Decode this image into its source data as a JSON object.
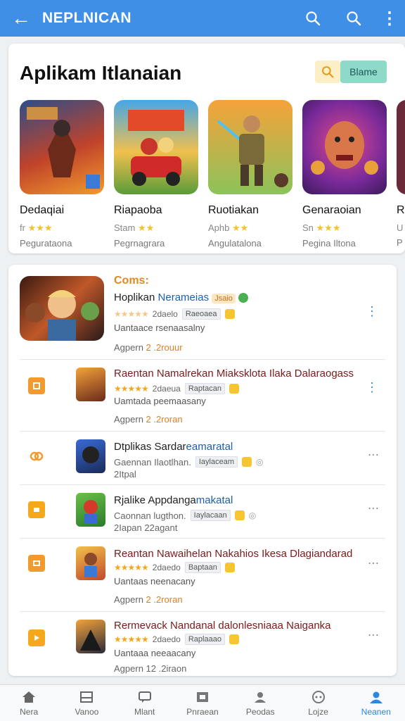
{
  "appbar": {
    "title": "NEPLNICAN",
    "back_icon": "arrow-left-icon",
    "bg": "#3f8fe6"
  },
  "featured": {
    "title": "Aplikam Itlanaian",
    "right_button": "Blame",
    "items": [
      {
        "name": "Dedaqiai",
        "rating": "fr",
        "category": "Pegurataona"
      },
      {
        "name": "Riapaoba",
        "rating": "Stam",
        "category": "Pegrnagrara"
      },
      {
        "name": "Ruotiakan",
        "rating": "Aphb",
        "category": "Angulatalona"
      },
      {
        "name": "Genaraoian",
        "rating": "Sn",
        "category": "Pegina Iltona"
      },
      {
        "name": "R",
        "rating": "U",
        "category": "P"
      }
    ]
  },
  "list": {
    "section_label": "Coms:",
    "rows": [
      {
        "title_a": "Hoplikan",
        "title_b": "Nerameias",
        "badge": "Jsaio",
        "rating": "2daelo",
        "tag": "Raeoaea",
        "desc": "Uantaace rsenaasalny",
        "sub_a": "Agpern",
        "sub_b": "2 .2rouur"
      },
      {
        "title": "Raentan Namalrekan Miaksklota Ilaka Dalaraogass",
        "rating": "2daeua",
        "tag": "Raptacan",
        "desc": "Uamtada peemaasany",
        "sub_a": "Agpern",
        "sub_b": "2 .2roran"
      },
      {
        "title_a": "Dtplikas Sardar",
        "title_b": "eamaratal",
        "desc": "Gaennan Ilaotlhan.",
        "tag": "Iaylaceam",
        "sub": "2Itpal"
      },
      {
        "title_a": "Rjalike Appdanga",
        "title_b": "makatal",
        "desc": "Caonnan lugthon.",
        "tag": "Iaylacaan",
        "sub": "2Iapan 22agant"
      },
      {
        "title": "Reantan Nawaihelan Nakahios Ikesa Dlagiandarad",
        "rating": "2daedo",
        "tag": "Baptaan",
        "desc": "Uantaas neenacany",
        "sub_a": "Agpern",
        "sub_b": "2 .2roran"
      },
      {
        "title": "Rermevack Nandanal dalonlesniaaa Naiganka",
        "rating": "2daedo",
        "tag": "Raplaaao",
        "desc": "Uantaaa neeaacany",
        "sub": "Agpern 12 .2iraon"
      }
    ]
  },
  "nav": {
    "items": [
      {
        "label": "Nera",
        "icon": "home-icon"
      },
      {
        "label": "Vanoo",
        "icon": "inbox-icon"
      },
      {
        "label": "Mlant",
        "icon": "chat-icon"
      },
      {
        "label": "Pnraean",
        "icon": "image-icon"
      },
      {
        "label": "Peodas",
        "icon": "person-icon"
      },
      {
        "label": "Lojze",
        "icon": "gamepad-icon"
      },
      {
        "label": "Neanen",
        "icon": "account-icon"
      }
    ],
    "active_color": "#2f86de"
  }
}
